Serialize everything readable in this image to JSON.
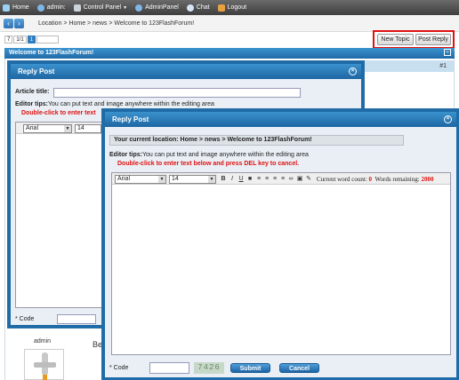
{
  "topbar": {
    "home": "Home",
    "user": "admin:",
    "control_panel": "Control Panel",
    "admin_panel": "AdminPanel",
    "chat": "Chat",
    "logout": "Logout"
  },
  "location": "Location > Home > news > Welcome to 123FlashForum!",
  "pager": {
    "page": "7",
    "of": "1/1",
    "current": "1"
  },
  "buttons": {
    "new_topic": "New Topic",
    "post_reply": "Post Reply"
  },
  "thread": {
    "title": "Welcome to 123FlashForum!",
    "minimize": "–",
    "post_no": "#1",
    "author": "admin",
    "post_text": "Be"
  },
  "dialog_back": {
    "title": "Reply Post",
    "close": "×",
    "article_title_label": "Article title:",
    "editor_tips_label": "Editor tips:",
    "editor_tips_text": "You can put text and image anywhere within the editing area",
    "dbl_click_text": "Double-click to enter text",
    "font": "Arial",
    "size": "14",
    "code_label": "* Code"
  },
  "dialog_front": {
    "title": "Reply Post",
    "close": "×",
    "current_location": "Your current location: Home > news > Welcome to 123FlashForum!",
    "editor_tips_label": "Editor tips:",
    "editor_tips_text": "You can put text and image anywhere within the editing area",
    "dbl_click_text": "Double-click to enter text below and press DEL key to cancel.",
    "font": "Arial",
    "size": "14",
    "word_count_label": "Current word count:",
    "word_count": "0",
    "words_remaining_label": "Words remaining:",
    "words_remaining": "2000",
    "code_label": "* Code",
    "captcha": "7426",
    "submit": "Submit",
    "cancel": "Cancel"
  }
}
